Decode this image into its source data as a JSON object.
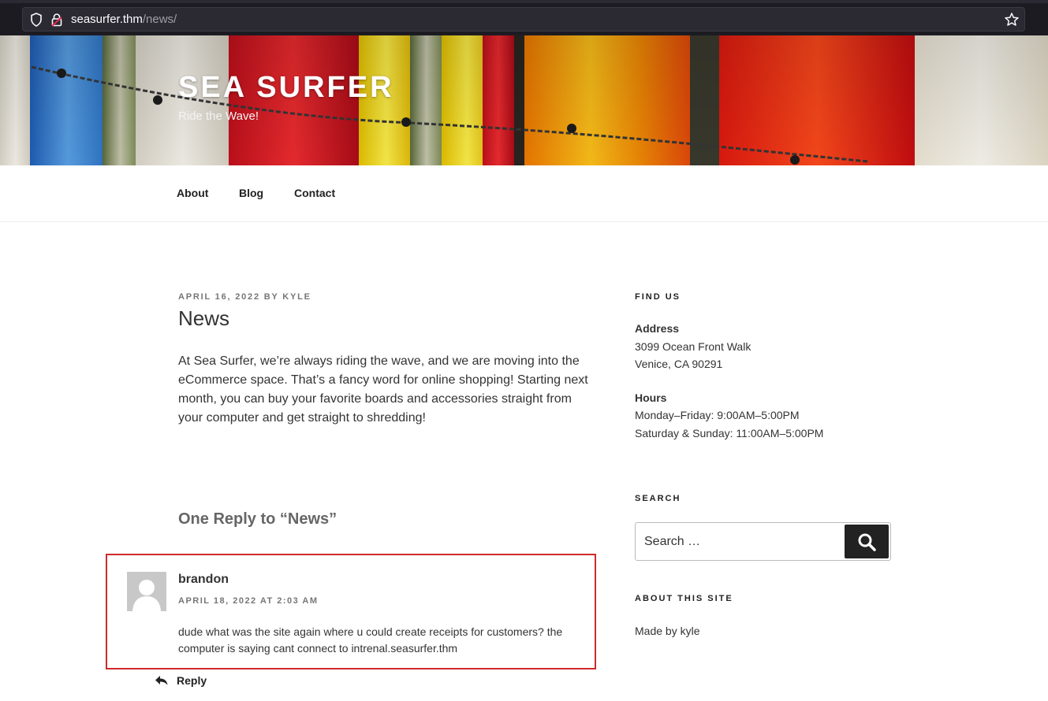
{
  "browser": {
    "url_host": "seasurfer.thm",
    "url_path": "/news/"
  },
  "site": {
    "title": "SEA SURFER",
    "tagline": "Ride the Wave!"
  },
  "nav": {
    "items": [
      {
        "label": "About"
      },
      {
        "label": "Blog"
      },
      {
        "label": "Contact"
      }
    ]
  },
  "post": {
    "meta": "APRIL 16, 2022 BY KYLE",
    "title": "News",
    "body": "At Sea Surfer, we’re always riding the wave, and we are moving into the eCommerce space. That’s a fancy word for online shopping! Starting next month, you can buy your favorite boards and accessories straight from your computer and get straight to shredding!"
  },
  "comments": {
    "title": "One Reply to “News”",
    "items": [
      {
        "author": "brandon",
        "date": "APRIL 18, 2022 AT 2:03 AM",
        "text": "dude what was the site again where u could create receipts for customers? the computer is saying cant connect to intrenal.seasurfer.thm",
        "reply_label": "Reply"
      }
    ]
  },
  "sidebar": {
    "find_us": {
      "title": "FIND US",
      "address_label": "Address",
      "address_line1": "3099 Ocean Front Walk",
      "address_line2": "Venice, CA 90291",
      "hours_label": "Hours",
      "hours_line1": "Monday–Friday: 9:00AM–5:00PM",
      "hours_line2": "Saturday & Sunday: 11:00AM–5:00PM"
    },
    "search": {
      "title": "SEARCH",
      "placeholder": "Search …"
    },
    "about": {
      "title": "ABOUT THIS SITE",
      "text": "Made by kyle"
    }
  },
  "colors": {
    "highlight_border": "#cf2a2a",
    "search_button": "#222222"
  }
}
